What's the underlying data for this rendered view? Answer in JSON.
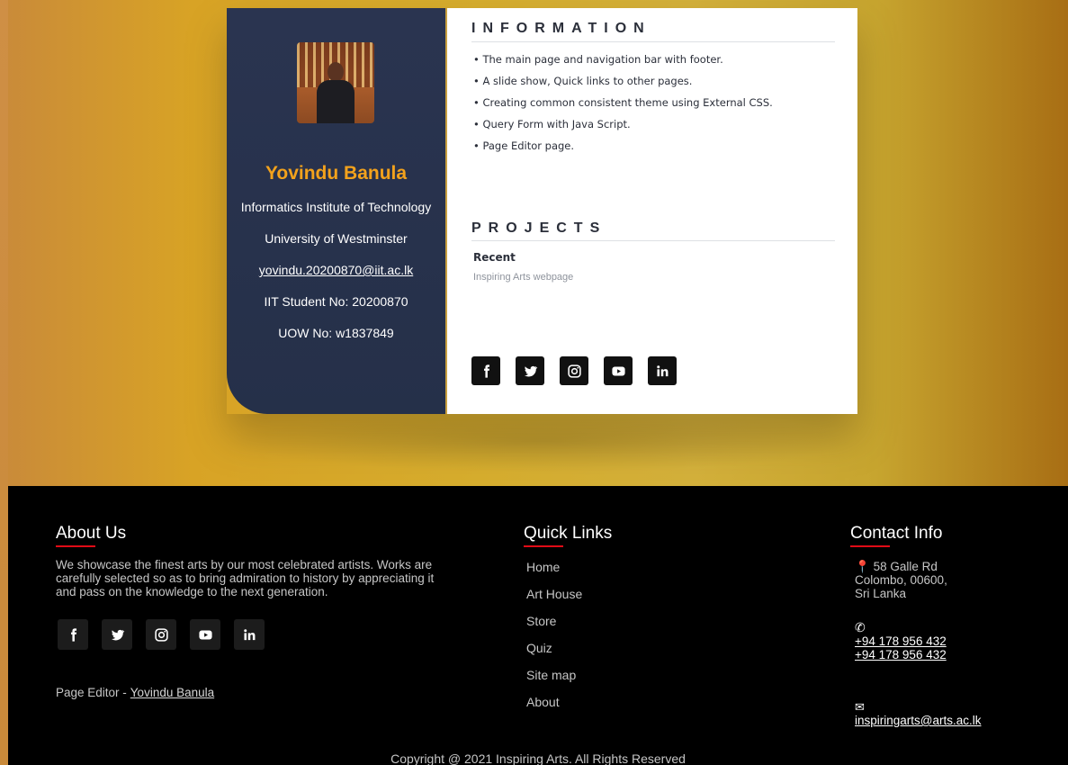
{
  "profile": {
    "name": "Yovindu Banula",
    "institute": "Informatics Institute of Technology",
    "university": "University of Westminster",
    "email": "yovindu.20200870@iit.ac.lk",
    "iit_no": "IIT Student No: 20200870",
    "uow_no": "UOW No: w1837849"
  },
  "information": {
    "title": "INFORMATION",
    "items": [
      "The main page and navigation bar with footer.",
      "A slide show, Quick links to other pages.",
      "Creating common consistent theme using External CSS.",
      "Query Form with Java Script.",
      "Page Editor page."
    ]
  },
  "projects": {
    "title": "PROJECTS",
    "recent_label": "Recent",
    "recent_item": "Inspiring Arts webpage"
  },
  "social_icons": [
    "facebook-icon",
    "twitter-icon",
    "instagram-icon",
    "youtube-icon",
    "linkedin-icon"
  ],
  "footer": {
    "about_title": "About Us",
    "about_text": "We showcase the finest arts by our most celebrated artists. Works are carefully selected so as to bring admiration to history by appreciating it and pass on the knowledge to the next generation.",
    "editor_label": "Page Editor -",
    "editor_name": "Yovindu Banula",
    "quick_title": "Quick Links",
    "quick_links": [
      "Home",
      "Art House",
      "Store",
      "Quiz",
      "Site map",
      "About"
    ],
    "contact_title": "Contact Info",
    "address_l1": "58 Galle Rd",
    "address_l2": "Colombo, 00600,",
    "address_l3": "Sri Lanka",
    "phone1": "+94 178 956 432",
    "phone2": "+94 178 956 432",
    "email": "inspiringarts@arts.ac.lk",
    "copyright": "Copyright @ 2021 Inspiring Arts. All Rights Reserved"
  },
  "colors": {
    "accent": "#f3a21c",
    "card_dark": "#253049",
    "underline_red": "#e10b16"
  }
}
